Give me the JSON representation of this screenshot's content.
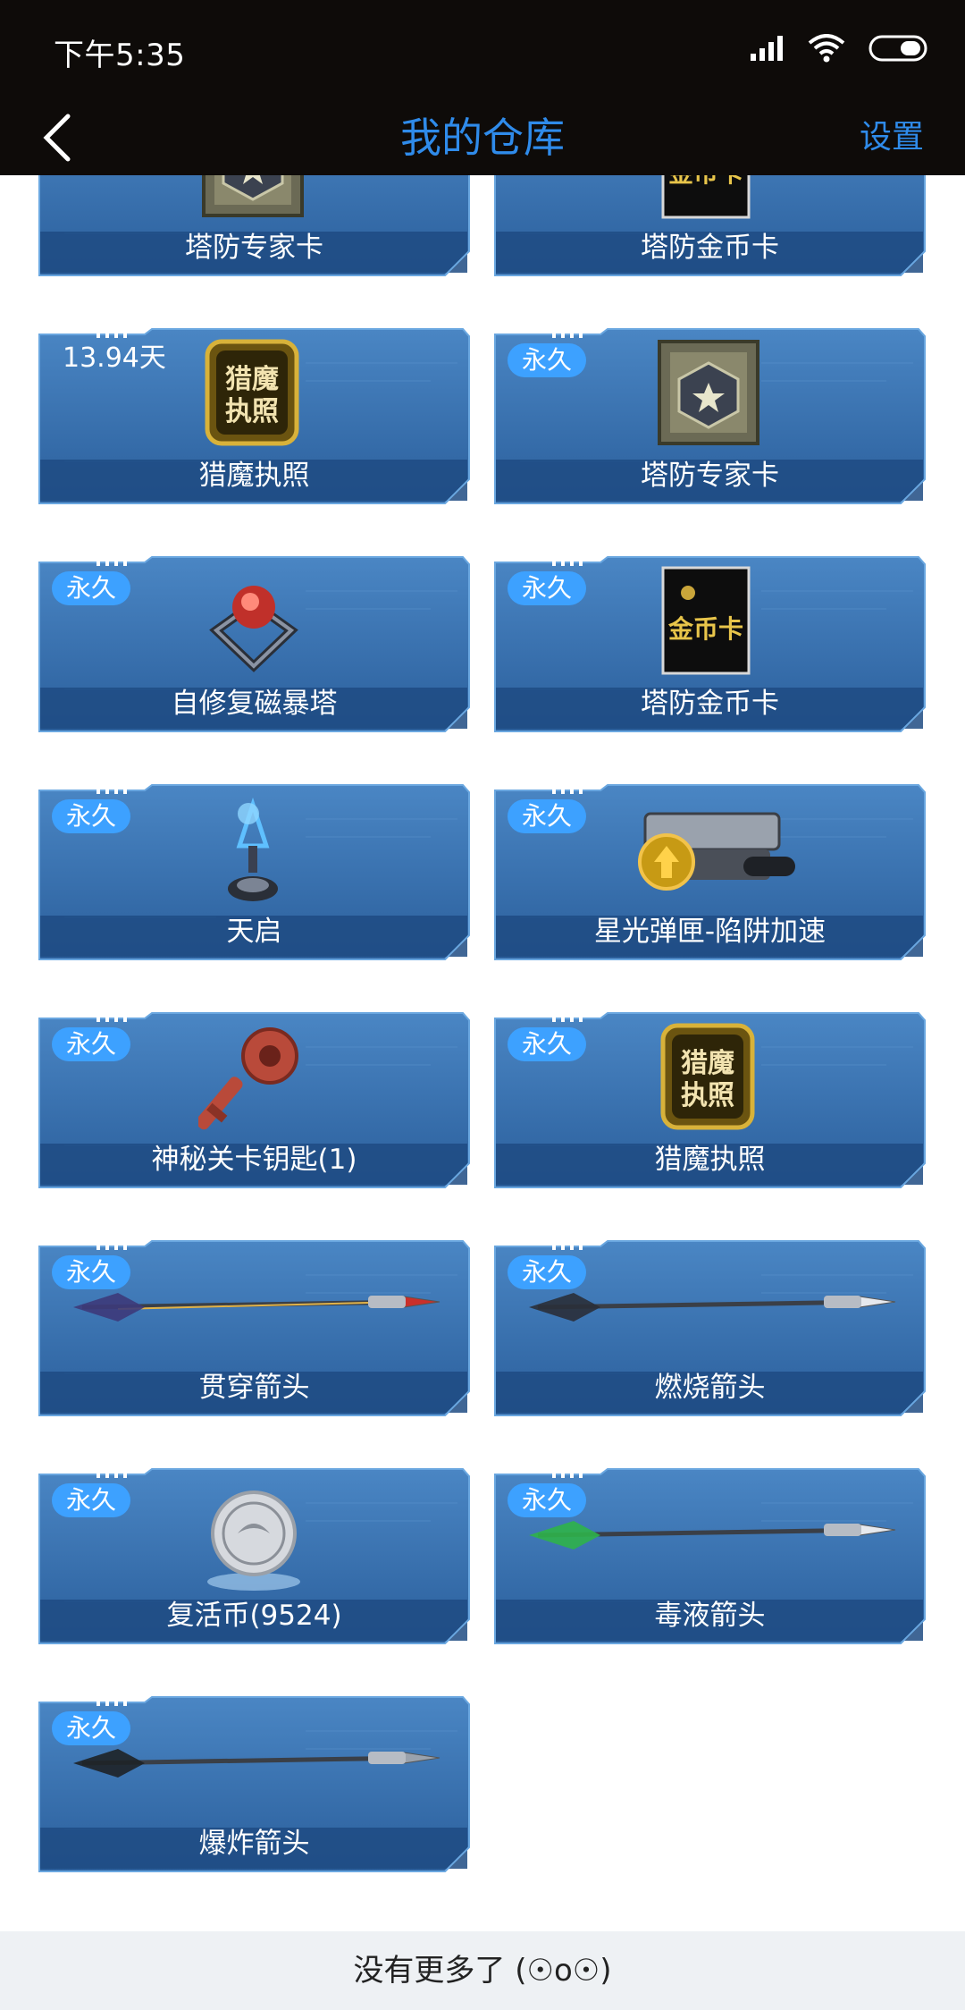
{
  "status": {
    "time": "下午5:35"
  },
  "nav": {
    "title": "我的仓库",
    "settings": "设置"
  },
  "items": [
    {
      "badge": "",
      "name": "塔防专家卡",
      "art": "expert-card-icon"
    },
    {
      "badge": "",
      "name": "塔防金币卡",
      "art": "gold-card-icon"
    },
    {
      "badge": "13.94天",
      "name": "猎魔执照",
      "art": "license-icon"
    },
    {
      "badge": "永久",
      "name": "塔防专家卡",
      "art": "expert-card-icon"
    },
    {
      "badge": "永久",
      "name": "自修复磁暴塔",
      "art": "tesla-tower-icon"
    },
    {
      "badge": "永久",
      "name": "塔防金币卡",
      "art": "gold-card-icon"
    },
    {
      "badge": "永久",
      "name": "天启",
      "art": "apocalypse-tower-icon"
    },
    {
      "badge": "永久",
      "name": "星光弹匣-陷阱加速",
      "art": "magazine-icon"
    },
    {
      "badge": "永久",
      "name": "神秘关卡钥匙(1)",
      "art": "key-icon"
    },
    {
      "badge": "永久",
      "name": "猎魔执照",
      "art": "license-icon"
    },
    {
      "badge": "永久",
      "name": "贯穿箭头",
      "art": "piercing-arrow-icon"
    },
    {
      "badge": "永久",
      "name": "燃烧箭头",
      "art": "burning-arrow-icon"
    },
    {
      "badge": "永久",
      "name": "复活币(9524)",
      "art": "revive-coin-icon"
    },
    {
      "badge": "永久",
      "name": "毒液箭头",
      "art": "venom-arrow-icon"
    },
    {
      "badge": "永久",
      "name": "爆炸箭头",
      "art": "explosive-arrow-icon"
    }
  ],
  "license_text": [
    "猎魔",
    "执照"
  ],
  "gold_card_text": "金币卡",
  "footer": "没有更多了 (☉o☉)",
  "colors": {
    "accent": "#2f8bea",
    "card": "#2f6aa8",
    "badge": "#3da1ff"
  }
}
